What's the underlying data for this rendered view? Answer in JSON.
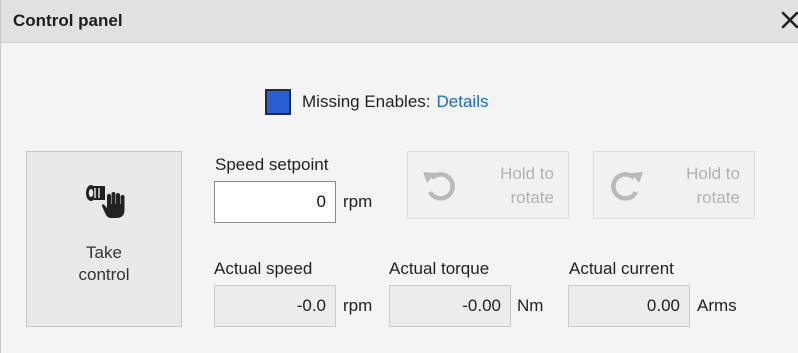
{
  "panel": {
    "title": "Control panel",
    "close_icon": "close-icon"
  },
  "status": {
    "indicator_color": "#2a5fd4",
    "missing_enables_label": "Missing Enables:",
    "details_link": "Details"
  },
  "take_control": {
    "icon": "hand-grab-icon",
    "label_line1": "Take",
    "label_line2": "control"
  },
  "speed_setpoint": {
    "label": "Speed setpoint",
    "value": "0",
    "unit": "rpm"
  },
  "hold_ccw": {
    "icon": "rotate-ccw-icon",
    "label_line1": "Hold to",
    "label_line2": "rotate"
  },
  "hold_cw": {
    "icon": "rotate-cw-icon",
    "label_line1": "Hold to",
    "label_line2": "rotate"
  },
  "actual_speed": {
    "label": "Actual speed",
    "value": "-0.0",
    "unit": "rpm"
  },
  "actual_torque": {
    "label": "Actual torque",
    "value": "-0.00",
    "unit": "Nm"
  },
  "actual_current": {
    "label": "Actual current",
    "value": "0.00",
    "unit": "Arms"
  }
}
